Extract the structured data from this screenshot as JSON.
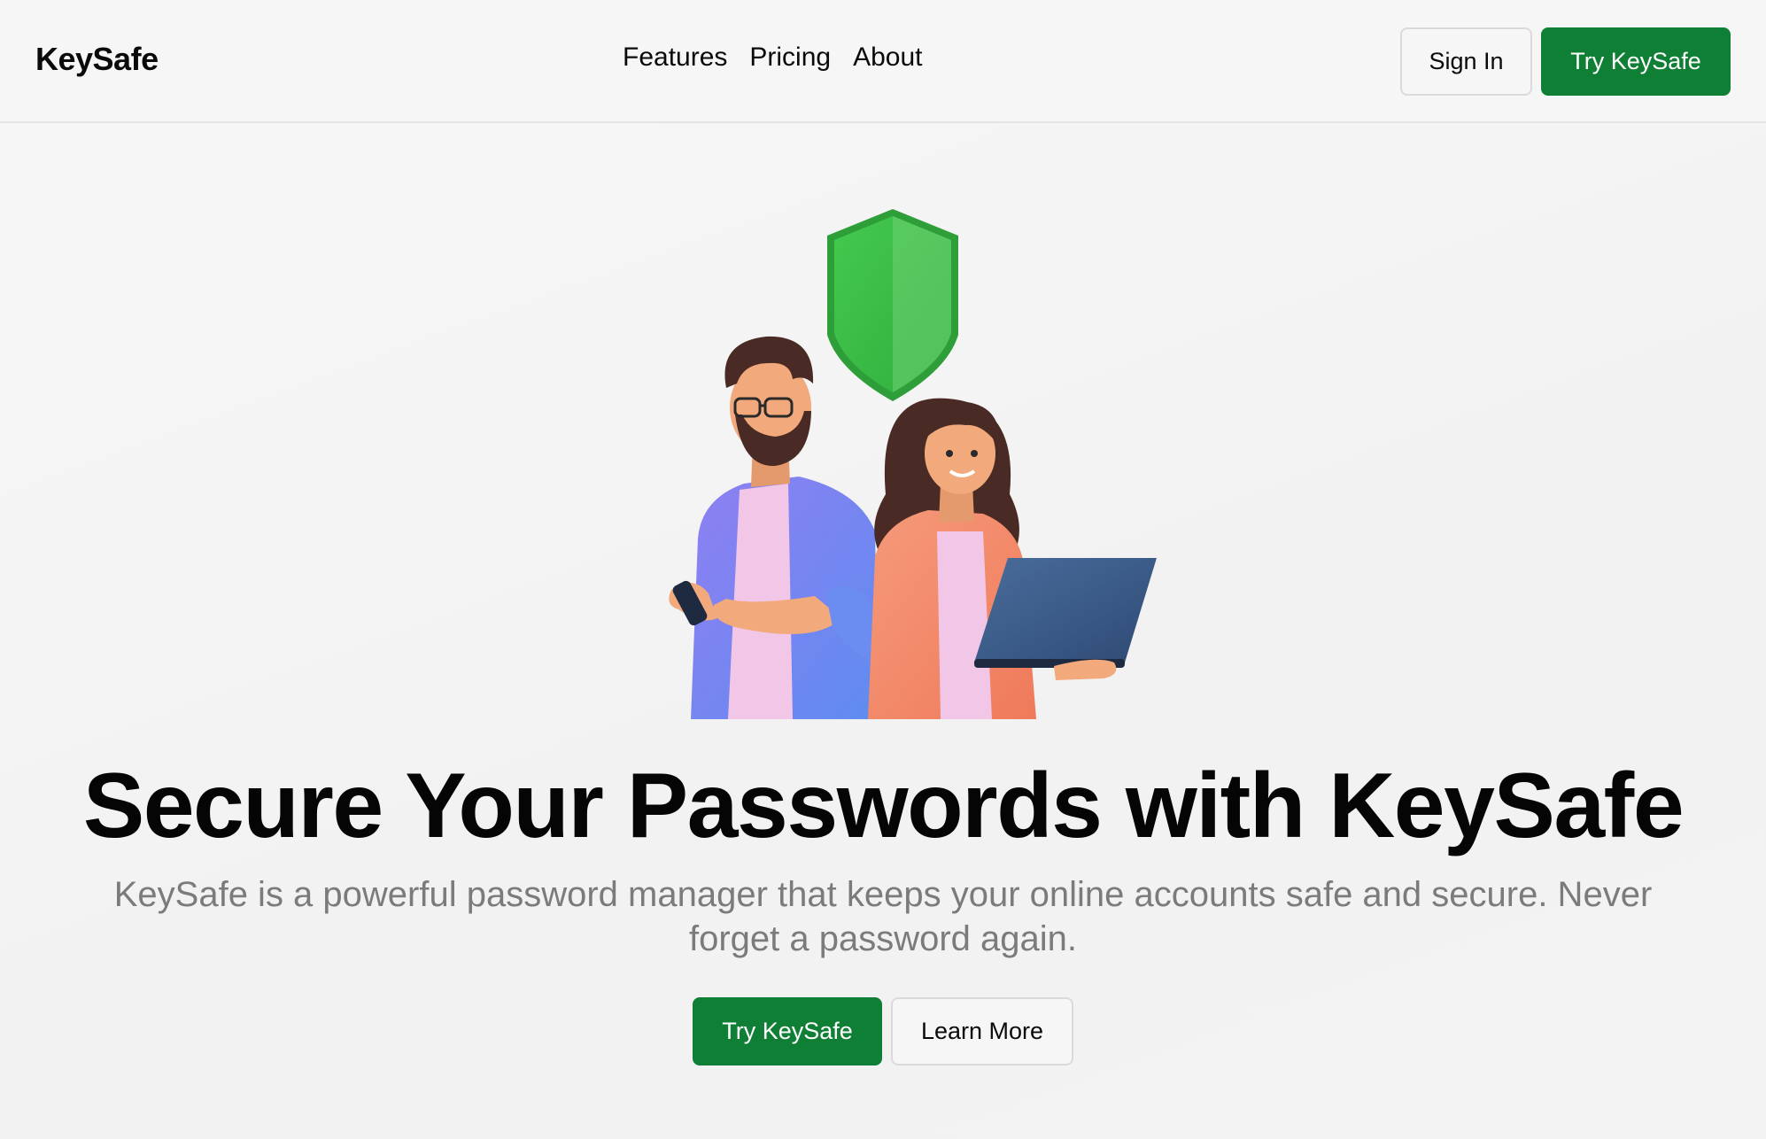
{
  "header": {
    "brand": "KeySafe",
    "nav": [
      {
        "label": "Features"
      },
      {
        "label": "Pricing"
      },
      {
        "label": "About"
      }
    ],
    "sign_in_label": "Sign In",
    "try_label": "Try KeySafe"
  },
  "hero": {
    "illustration": "people-with-shield-illustration",
    "title": "Secure Your Passwords with KeySafe",
    "subtitle": "KeySafe is a powerful password manager that keeps your online accounts safe and secure. Never forget a password again.",
    "primary_cta": "Try KeySafe",
    "secondary_cta": "Learn More"
  },
  "colors": {
    "accent": "#0e7f34",
    "shield": "#3cbd48",
    "text": "#0a0a0a",
    "muted": "#7b7b7b"
  }
}
